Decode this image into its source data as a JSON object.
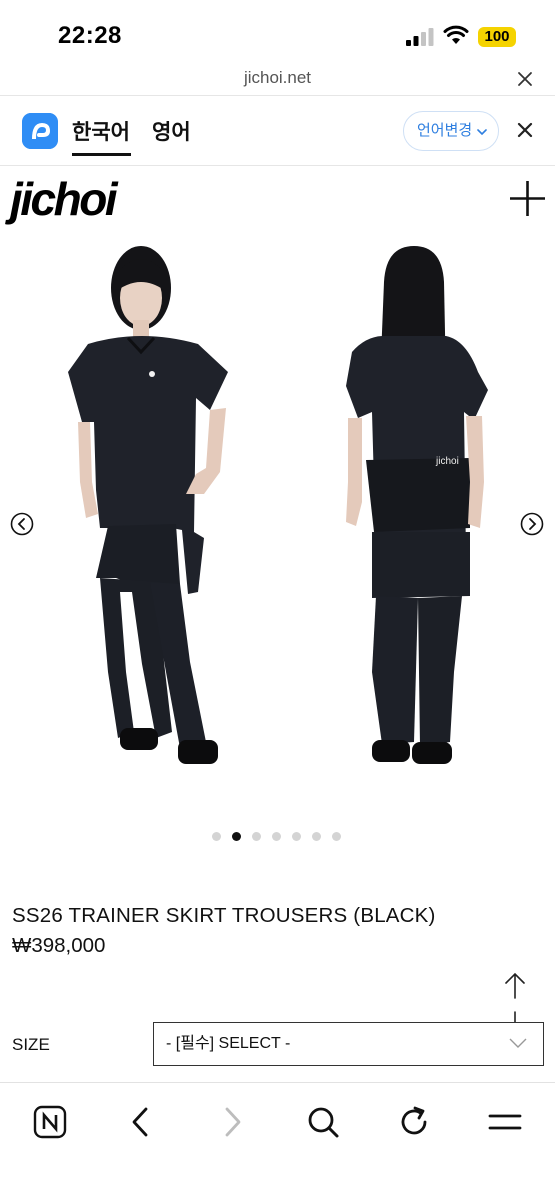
{
  "status_bar": {
    "time": "22:28",
    "battery": "100",
    "icons": [
      "cellular-signal-icon",
      "wifi-icon",
      "battery-icon"
    ]
  },
  "browser": {
    "url": "jichoi.net",
    "close_icon": "close-icon"
  },
  "translate_bar": {
    "logo_icon": "papago-icon",
    "tabs": [
      {
        "label": "한국어",
        "selected": true
      },
      {
        "label": "영어",
        "selected": false
      }
    ],
    "change_language_label": "언어변경",
    "accent_color": "#2f7fe0"
  },
  "site": {
    "logo": "jichoi",
    "menu_icon": "plus-icon"
  },
  "product": {
    "title": "SS26 TRAINER SKIRT TROUSERS (BLACK)",
    "price": "₩398,000",
    "image_count": 7,
    "active_image_index": 1,
    "size_label": "SIZE",
    "size_select_value": "- [필수] SELECT -"
  },
  "toolbar": {
    "icons": [
      "naver-home-icon",
      "back-icon",
      "forward-icon",
      "search-icon",
      "refresh-icon",
      "menu-icon"
    ]
  }
}
